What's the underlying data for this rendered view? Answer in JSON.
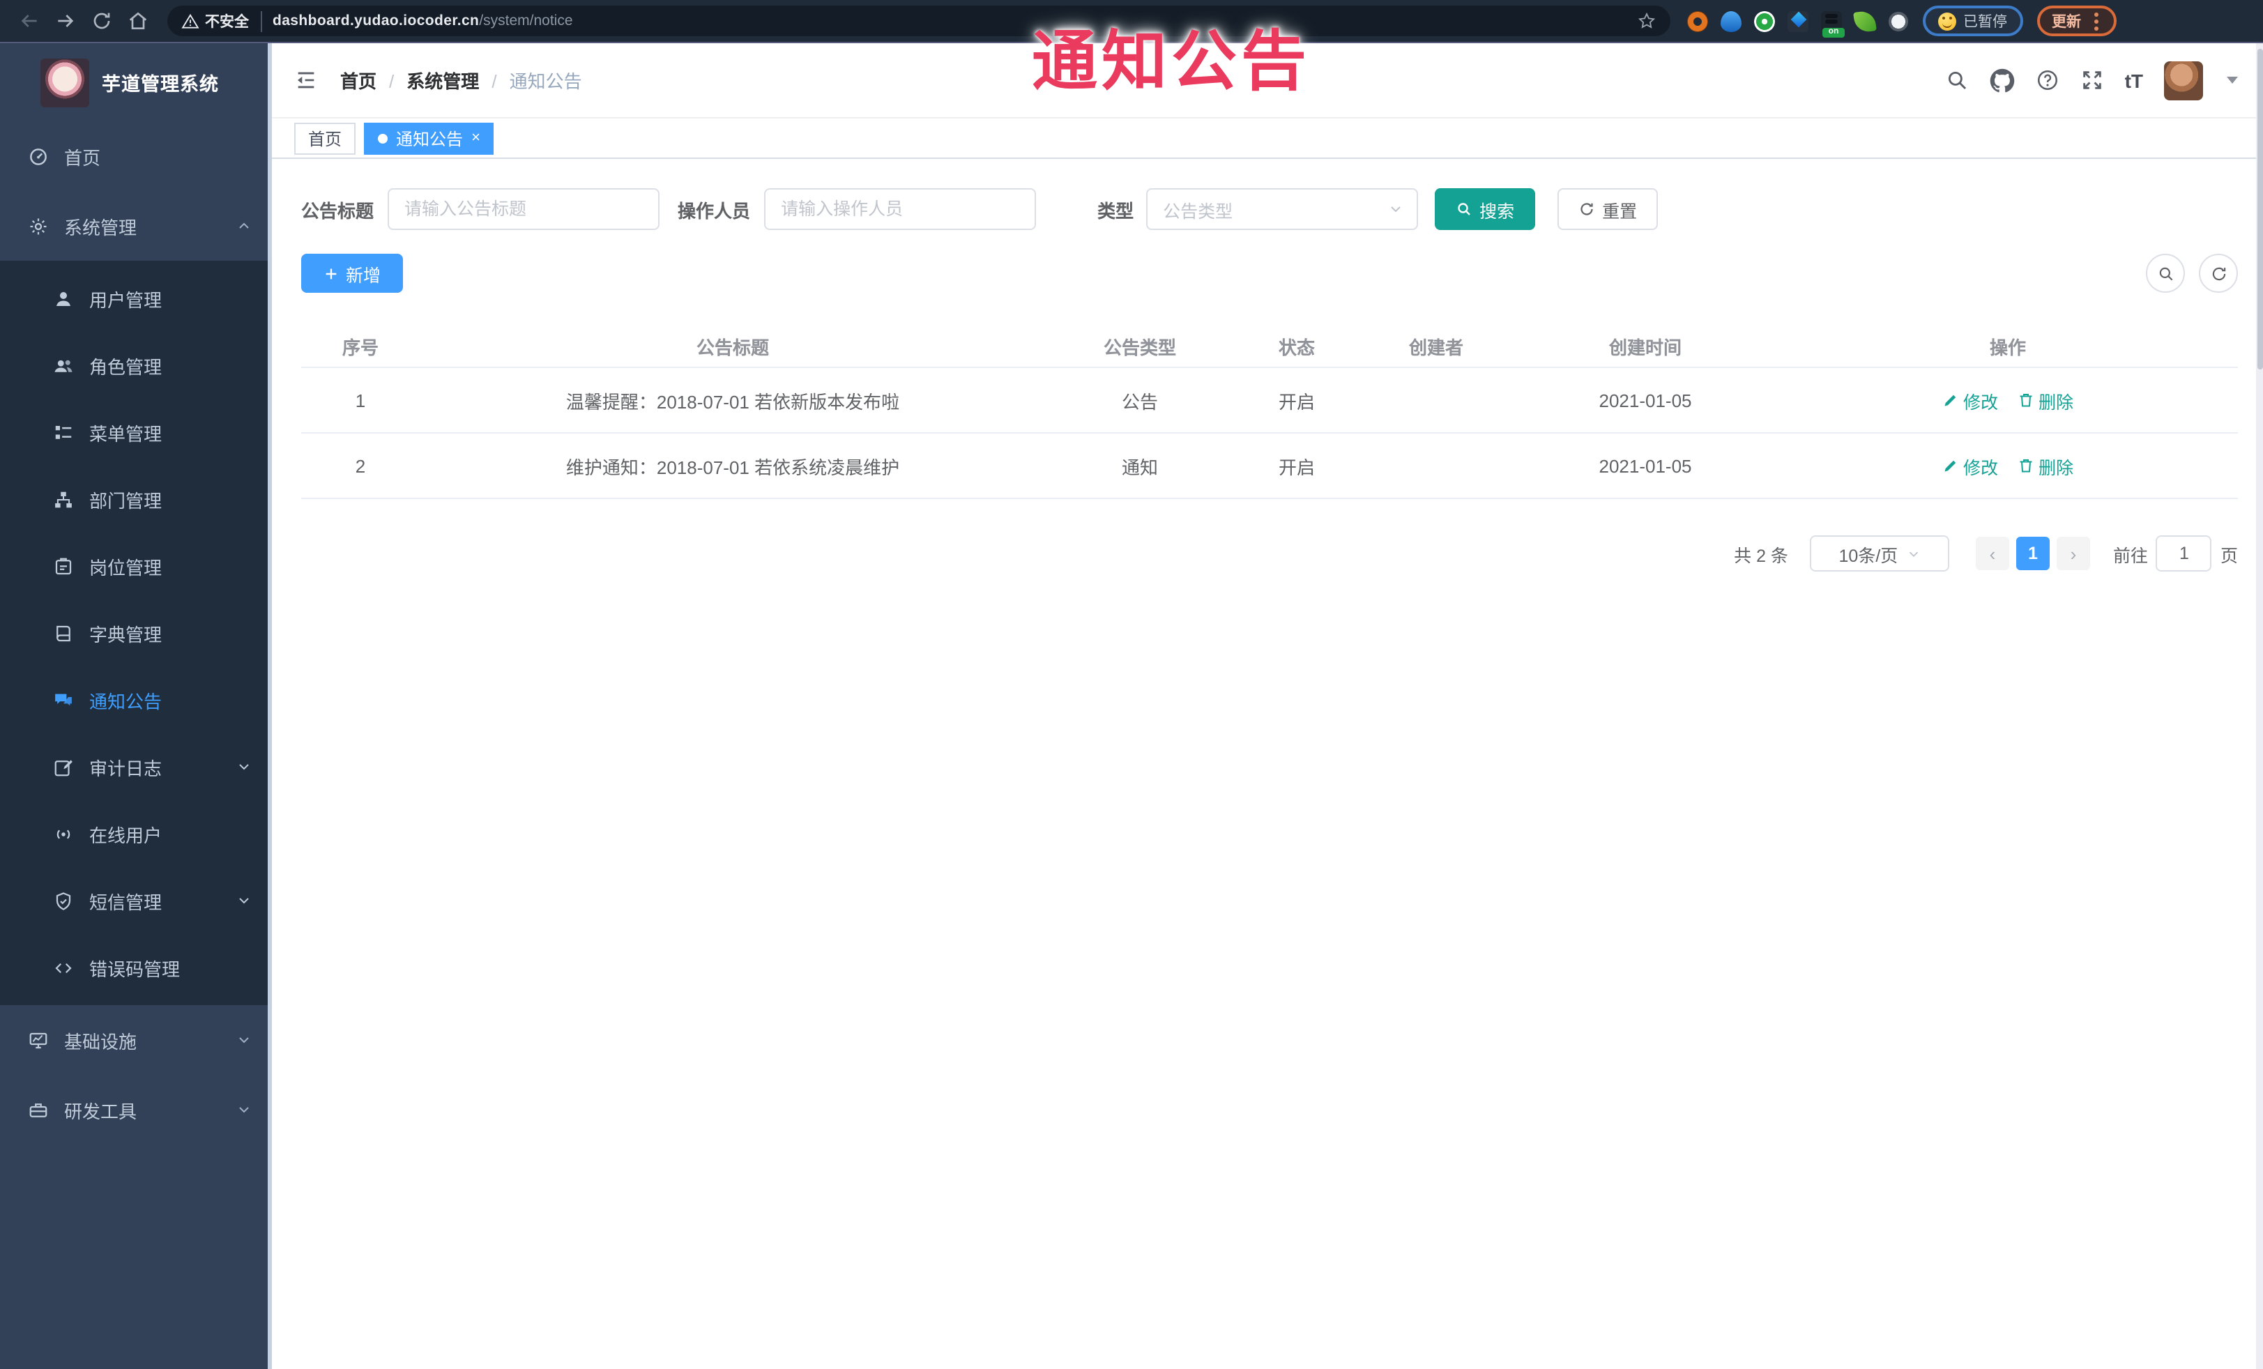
{
  "browser": {
    "security_label": "不安全",
    "url_host": "dashboard.yudao.iocoder.cn",
    "url_path": "/system/notice",
    "paused_label": "已暂停",
    "update_label": "更新",
    "extension_badge": "on"
  },
  "overlay_title": "通知公告",
  "sidebar": {
    "app_title": "芋道管理系统",
    "menu": [
      {
        "label": "首页"
      },
      {
        "label": "系统管理",
        "children": [
          {
            "label": "用户管理"
          },
          {
            "label": "角色管理"
          },
          {
            "label": "菜单管理"
          },
          {
            "label": "部门管理"
          },
          {
            "label": "岗位管理"
          },
          {
            "label": "字典管理"
          },
          {
            "label": "通知公告"
          },
          {
            "label": "审计日志"
          },
          {
            "label": "在线用户"
          },
          {
            "label": "短信管理"
          },
          {
            "label": "错误码管理"
          }
        ]
      },
      {
        "label": "基础设施"
      },
      {
        "label": "研发工具"
      }
    ]
  },
  "header": {
    "breadcrumb": [
      "首页",
      "系统管理",
      "通知公告"
    ]
  },
  "tabs": [
    {
      "label": "首页",
      "active": false
    },
    {
      "label": "通知公告",
      "active": true,
      "close_label": "×"
    }
  ],
  "filters": {
    "title_label": "公告标题",
    "title_placeholder": "请输入公告标题",
    "operator_label": "操作人员",
    "operator_placeholder": "请输入操作人员",
    "type_label": "类型",
    "type_placeholder": "公告类型",
    "search_label": "搜索",
    "reset_label": "重置"
  },
  "toolbar": {
    "add_label": "新增"
  },
  "table": {
    "headers": [
      "序号",
      "公告标题",
      "公告类型",
      "状态",
      "创建者",
      "创建时间",
      "操作"
    ],
    "rows": [
      {
        "no": "1",
        "title": "温馨提醒：2018-07-01 若依新版本发布啦",
        "type": "公告",
        "status": "开启",
        "creator": "",
        "time": "2021-01-05"
      },
      {
        "no": "2",
        "title": "维护通知：2018-07-01 若依系统凌晨维护",
        "type": "通知",
        "status": "开启",
        "creator": "",
        "time": "2021-01-05"
      }
    ],
    "edit_label": "修改",
    "delete_label": "删除"
  },
  "pagination": {
    "total_label": "共 2 条",
    "page_size_label": "10条/页",
    "prev_label": "‹",
    "next_label": "›",
    "current_page": "1",
    "goto_label": "前往",
    "goto_value": "1",
    "page_suffix_label": "页"
  },
  "icons": {
    "search": "magnifier",
    "github": "octocat",
    "help": "question-circle",
    "fullscreen": "expand-arrows",
    "font_size": "tT",
    "add": "plus",
    "reset": "refresh",
    "edit": "pencil",
    "delete": "trash",
    "address_security": "warning-triangle",
    "bookmark": "star-outline"
  },
  "colors": {
    "primary": "#409eff",
    "accent_teal": "#14a294",
    "overlay_red": "#ea3a5d",
    "sidebar_bg": "#334158",
    "submenu_bg": "#1f2d3d",
    "browser_bar_bg": "#202b39"
  }
}
